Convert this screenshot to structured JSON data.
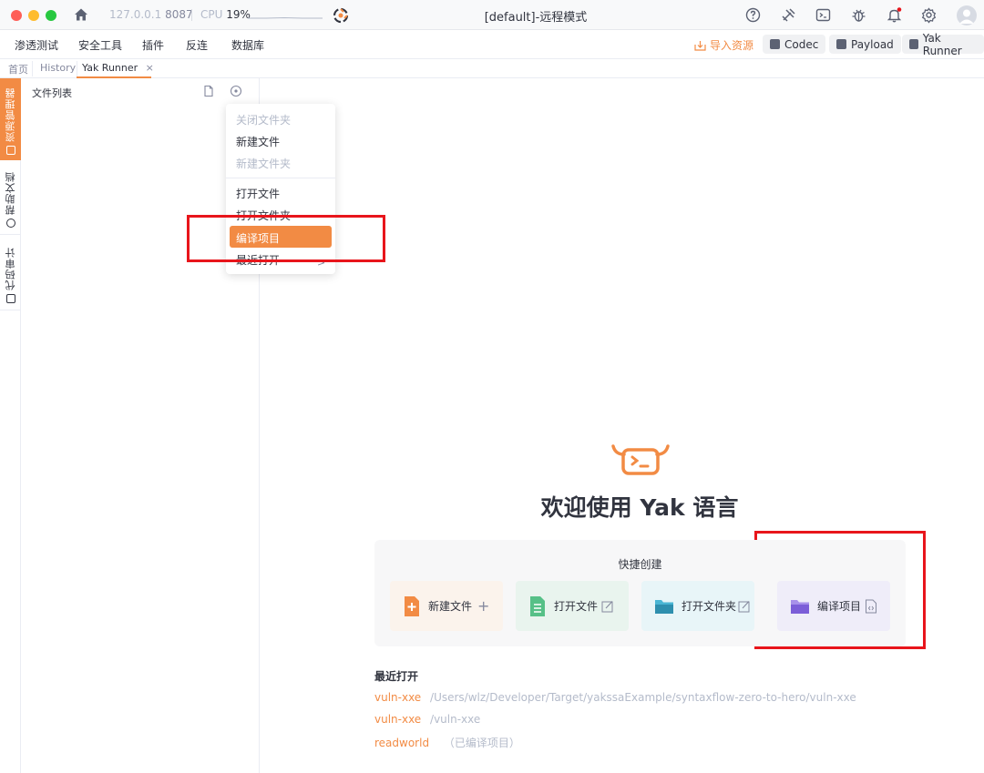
{
  "titlebar": {
    "ip": "127.0.0.1",
    "port": "8087",
    "cpu_label": "CPU",
    "cpu_value": "19%",
    "title": "[default]-远程模式"
  },
  "menubar": {
    "items": [
      "渗透测试",
      "安全工具",
      "插件",
      "反连",
      "数据库"
    ],
    "import_label": "导入资源",
    "tools": [
      {
        "label": "Codec",
        "icon": "codec-icon"
      },
      {
        "label": "Payload",
        "icon": "payload-icon"
      },
      {
        "label": "Yak Runner",
        "icon": "terminal-icon"
      }
    ]
  },
  "tabs": [
    {
      "label": "首页"
    },
    {
      "label": "History"
    },
    {
      "label": "Yak Runner",
      "close": "×",
      "active": true
    }
  ],
  "sidebar": {
    "items": [
      {
        "label": "资源管理器",
        "active": true
      },
      {
        "label": "帮助文档"
      },
      {
        "label": "代码审计"
      }
    ]
  },
  "file_panel": {
    "title": "文件列表"
  },
  "dropdown": {
    "items": [
      {
        "label": "关闭文件夹",
        "disabled": true
      },
      {
        "label": "新建文件",
        "disabled": false
      },
      {
        "label": "新建文件夹",
        "disabled": true
      },
      {
        "label": "打开文件",
        "disabled": false
      },
      {
        "label": "打开文件夹",
        "disabled": false
      },
      {
        "label": "编译项目",
        "active": true
      },
      {
        "label": "最近打开",
        "submenu": true
      }
    ],
    "submenu_arrow": ">"
  },
  "welcome": {
    "title": "欢迎使用 Yak 语言",
    "quick_title": "快捷创建",
    "cards": [
      {
        "label": "新建文件",
        "suffix": "+",
        "bg": "#fbf3ec",
        "icon_color": "#f28b44"
      },
      {
        "label": "打开文件",
        "bg": "#e9f4ee",
        "icon_color": "#56c087"
      },
      {
        "label": "打开文件夹",
        "bg": "#e8f5f8",
        "icon_color": "#4ab6d4"
      },
      {
        "label": "编译项目",
        "bg": "#efedf9",
        "icon_color": "#8b6fdc"
      }
    ],
    "recent_title": "最近打开",
    "recent": [
      {
        "name": "vuln-xxe",
        "path": "/Users/wlz/Developer/Target/yakssaExample/syntaxflow-zero-to-hero/vuln-xxe"
      },
      {
        "name": "vuln-xxe",
        "path": "/vuln-xxe"
      },
      {
        "name": "readworld",
        "path": "（已编译项目）"
      }
    ]
  },
  "colors": {
    "accent": "#f28b44",
    "highlight_box": "#e8151b"
  }
}
